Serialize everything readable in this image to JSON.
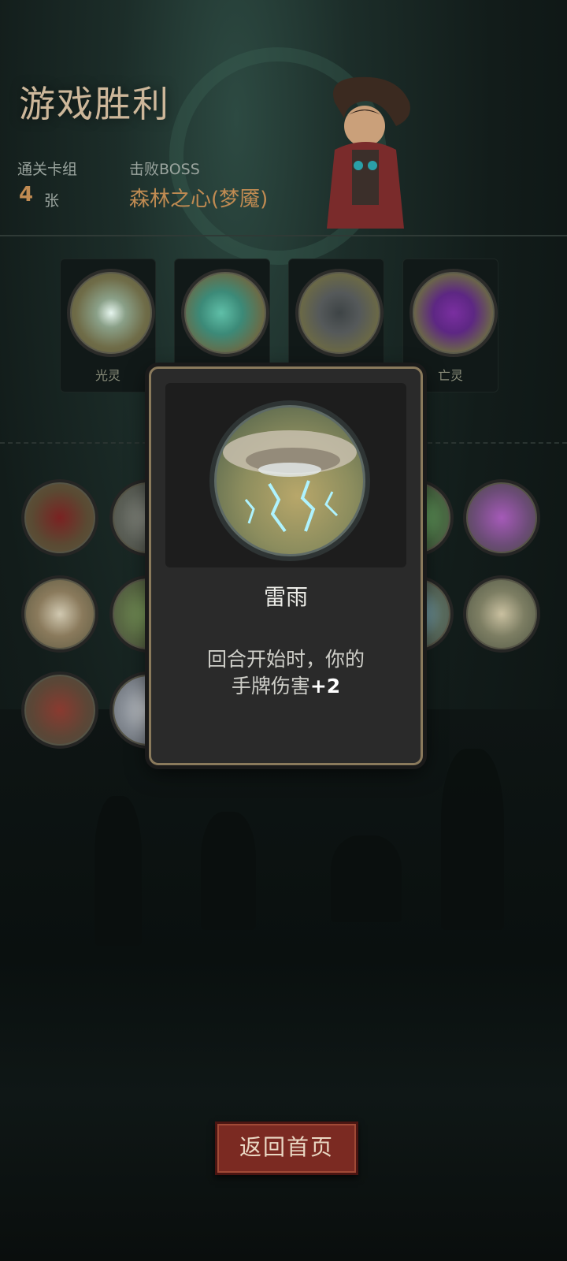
{
  "header": {
    "title": "游戏胜利",
    "deck_label": "通关卡组",
    "deck_count": "4",
    "deck_unit": "张",
    "boss_label": "击败BOSS",
    "boss_name": "森林之心(梦魇)"
  },
  "deck_slots": [
    {
      "label": "光灵",
      "icon": "light-spirit-icon"
    },
    {
      "label": "",
      "icon": "water-serpent-icon"
    },
    {
      "label": "",
      "icon": "tornado-icon"
    },
    {
      "label": "亡灵",
      "icon": "undead-spirit-icon"
    }
  ],
  "relics": [
    {
      "icon": "cursed-card-icon"
    },
    {
      "icon": "zombie-icon"
    },
    {
      "icon": "music-note-icon"
    },
    {
      "icon": "zombie-music-icon"
    },
    {
      "icon": "warrior-slash-icon"
    },
    {
      "icon": "ghost-tree-icon"
    },
    {
      "icon": "blue-flower-icon"
    },
    {
      "icon": "thunderstorm-icon"
    },
    {
      "icon": "bloody-hands-icon"
    },
    {
      "icon": "shark-icon"
    }
  ],
  "popup": {
    "name": "雷雨",
    "desc_line1": "回合开始时，你的",
    "desc_line2_prefix": "手牌伤害",
    "desc_line2_bonus": "+2",
    "icon": "thunderstorm-icon"
  },
  "footer": {
    "home_button": "返回首页"
  },
  "colors": {
    "title": "#cdb79a",
    "accent": "#c08b52",
    "button": "#7b2a22"
  }
}
